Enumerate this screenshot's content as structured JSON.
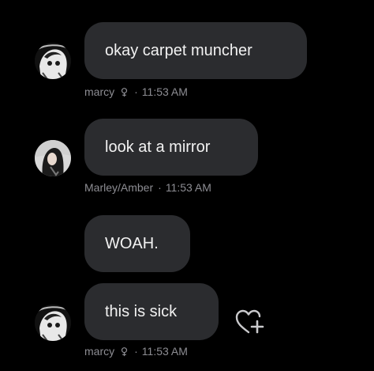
{
  "messages": [
    {
      "author": "marcy",
      "author_badge": "flower-badge-icon",
      "time": "11:53 AM",
      "text": "okay carpet muncher",
      "avatar": "anime-avatar-icon"
    },
    {
      "author": "Marley/Amber",
      "time": "11:53 AM",
      "text": "look at a mirror",
      "avatar": "photo-avatar"
    },
    {
      "text": "WOAH."
    },
    {
      "author": "marcy",
      "author_badge": "flower-badge-icon",
      "time": "11:53 AM",
      "text": "this is sick",
      "avatar": "anime-avatar-icon"
    }
  ],
  "separator": "·",
  "reaction_button": {
    "icon": "heart-plus-icon"
  },
  "colors": {
    "background": "#000000",
    "bubble": "#2b2c2f",
    "bubble_text": "#f2f2f2",
    "meta_text": "#8d8d93"
  }
}
